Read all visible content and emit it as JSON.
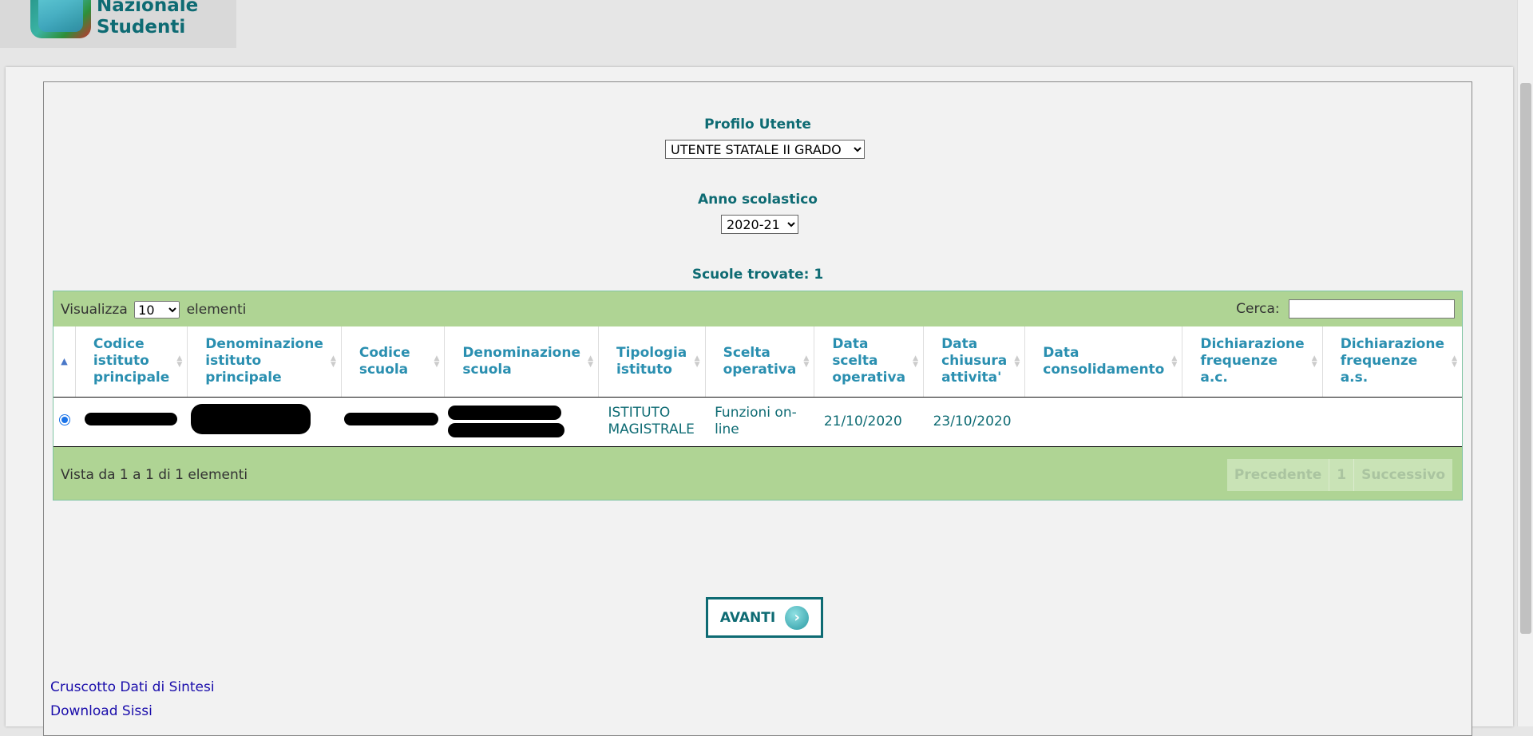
{
  "header": {
    "logo_line1": "Nazionale",
    "logo_line2": "Studenti"
  },
  "form": {
    "profile_label": "Profilo Utente",
    "profile_value": "UTENTE STATALE II GRADO",
    "year_label": "Anno scolastico",
    "year_value": "2020-21",
    "found_text": "Scuole trovate: 1"
  },
  "table": {
    "show_label": "Visualizza",
    "show_value": "10",
    "show_suffix": "elementi",
    "search_label": "Cerca:",
    "search_value": "",
    "columns": [
      "Codice istituto principale",
      "Denominazione istituto principale",
      "Codice scuola",
      "Denominazione scuola",
      "Tipologia istituto",
      "Scelta operativa",
      "Data scelta operativa",
      "Data chiusura attivita'",
      "Data consolidamento",
      "Dichiarazione frequenze a.c.",
      "Dichiarazione frequenze a.s."
    ],
    "rows": [
      {
        "selected": true,
        "codice_istituto": "",
        "denominazione_istituto": "",
        "codice_scuola": "",
        "denominazione_scuola": "",
        "tipologia": "ISTITUTO MAGISTRALE",
        "scelta_operativa": "Funzioni on-line",
        "data_scelta": "21/10/2020",
        "data_chiusura": "23/10/2020",
        "data_consolidamento": "",
        "frequenze_ac": "",
        "frequenze_as": ""
      }
    ],
    "info_text": "Vista da 1 a 1 di 1 elementi",
    "pager": {
      "prev": "Precedente",
      "page": "1",
      "next": "Successivo"
    }
  },
  "actions": {
    "next_label": "AVANTI"
  },
  "links": {
    "cruscotto": "Cruscotto Dati di Sintesi",
    "download": "Download Sissi"
  },
  "colors": {
    "teal": "#0e6b73",
    "header_blue": "#2a8fb0",
    "green_band": "#afd494",
    "link_blue": "#1a0dab"
  }
}
